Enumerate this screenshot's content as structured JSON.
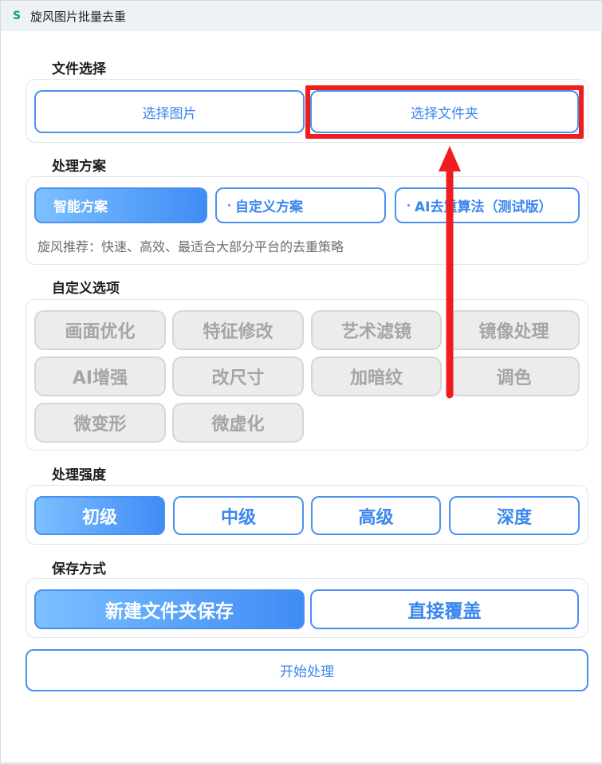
{
  "window": {
    "title": "旋风图片批量去重",
    "icon": "app-logo-s"
  },
  "file_select": {
    "title": "文件选择",
    "select_image": "选择图片",
    "select_folder": "选择文件夹"
  },
  "scheme": {
    "title": "处理方案",
    "options": [
      "智能方案",
      "自定义方案",
      "AI去重算法（测试版）"
    ],
    "selected": "智能方案",
    "description": "旋风推荐：快速、高效、最适合大部分平台的去重策略"
  },
  "custom_options": {
    "title": "自定义选项",
    "items": [
      "画面优化",
      "特征修改",
      "艺术滤镜",
      "镜像处理",
      "AI增强",
      "改尺寸",
      "加暗纹",
      "调色",
      "微变形",
      "微虚化"
    ],
    "enabled": false
  },
  "strength": {
    "title": "处理强度",
    "options": [
      "初级",
      "中级",
      "高级",
      "深度"
    ],
    "selected": "初级"
  },
  "save": {
    "title": "保存方式",
    "options": [
      "新建文件夹保存",
      "直接覆盖"
    ],
    "selected": "新建文件夹保存"
  },
  "start_button": "开始处理",
  "colors": {
    "accent": "#3a86ee",
    "annotation": "#ee1e1e",
    "disabled_bg": "#ececec"
  }
}
